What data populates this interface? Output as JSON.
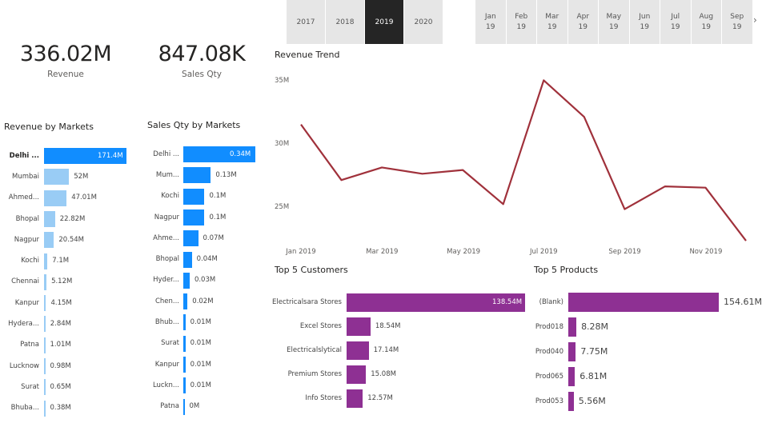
{
  "year_slicer": {
    "options": [
      "2017",
      "2018",
      "2019",
      "2020"
    ],
    "selected": "2019"
  },
  "month_slicer": {
    "options": [
      "Jan\n19",
      "Feb\n19",
      "Mar\n19",
      "Apr\n19",
      "May\n19",
      "Jun\n19",
      "Jul\n19",
      "Aug\n19",
      "Sep\n19"
    ]
  },
  "cards": {
    "revenue": {
      "value": "336.02M",
      "label": "Revenue"
    },
    "sales_qty": {
      "value": "847.08K",
      "label": "Sales Qty"
    }
  },
  "revenue_by_markets": {
    "title": "Revenue by Markets",
    "color": "#99ccf5",
    "highlight_color": "#118dff",
    "items": [
      {
        "cat": "Delhi ...",
        "value": 171.4,
        "label": "171.4M"
      },
      {
        "cat": "Mumbai",
        "value": 52,
        "label": "52M"
      },
      {
        "cat": "Ahmed...",
        "value": 47.01,
        "label": "47.01M"
      },
      {
        "cat": "Bhopal",
        "value": 22.82,
        "label": "22.82M"
      },
      {
        "cat": "Nagpur",
        "value": 20.54,
        "label": "20.54M"
      },
      {
        "cat": "Kochi",
        "value": 7.1,
        "label": "7.1M"
      },
      {
        "cat": "Chennai",
        "value": 5.12,
        "label": "5.12M"
      },
      {
        "cat": "Kanpur",
        "value": 4.15,
        "label": "4.15M"
      },
      {
        "cat": "Hydera...",
        "value": 2.84,
        "label": "2.84M"
      },
      {
        "cat": "Patna",
        "value": 1.01,
        "label": "1.01M"
      },
      {
        "cat": "Lucknow",
        "value": 0.98,
        "label": "0.98M"
      },
      {
        "cat": "Surat",
        "value": 0.65,
        "label": "0.65M"
      },
      {
        "cat": "Bhuba...",
        "value": 0.38,
        "label": "0.38M"
      }
    ]
  },
  "sales_qty_by_markets": {
    "title": "Sales Qty by Markets",
    "color": "#118dff",
    "items": [
      {
        "cat": "Delhi ...",
        "value": 0.34,
        "label": "0.34M"
      },
      {
        "cat": "Mum...",
        "value": 0.13,
        "label": "0.13M"
      },
      {
        "cat": "Kochi",
        "value": 0.1,
        "label": "0.1M"
      },
      {
        "cat": "Nagpur",
        "value": 0.1,
        "label": "0.1M"
      },
      {
        "cat": "Ahme...",
        "value": 0.07,
        "label": "0.07M"
      },
      {
        "cat": "Bhopal",
        "value": 0.04,
        "label": "0.04M"
      },
      {
        "cat": "Hyder...",
        "value": 0.03,
        "label": "0.03M"
      },
      {
        "cat": "Chen...",
        "value": 0.02,
        "label": "0.02M"
      },
      {
        "cat": "Bhub...",
        "value": 0.01,
        "label": "0.01M"
      },
      {
        "cat": "Surat",
        "value": 0.01,
        "label": "0.01M"
      },
      {
        "cat": "Kanpur",
        "value": 0.01,
        "label": "0.01M"
      },
      {
        "cat": "Luckn...",
        "value": 0.01,
        "label": "0.01M"
      },
      {
        "cat": "Patna",
        "value": 0,
        "label": "0M"
      }
    ]
  },
  "revenue_trend": {
    "title": "Revenue Trend",
    "color": "#a0313b",
    "y_ticks": [
      "35M",
      "30M",
      "25M"
    ],
    "x_ticks": [
      "Jan 2019",
      "Mar 2019",
      "May 2019",
      "Jul 2019",
      "Sep 2019",
      "Nov 2019"
    ]
  },
  "top5_customers": {
    "title": "Top 5 Customers",
    "color": "#8e3093",
    "items": [
      {
        "cat": "Electricalsara Stores",
        "value": 138.54,
        "label": "138.54M"
      },
      {
        "cat": "Excel Stores",
        "value": 18.54,
        "label": "18.54M"
      },
      {
        "cat": "Electricalslytical",
        "value": 17.14,
        "label": "17.14M"
      },
      {
        "cat": "Premium Stores",
        "value": 15.08,
        "label": "15.08M"
      },
      {
        "cat": "Info Stores",
        "value": 12.57,
        "label": "12.57M"
      }
    ]
  },
  "top5_products": {
    "title": "Top 5 Products",
    "color": "#8e3093",
    "items": [
      {
        "cat": "(Blank)",
        "value": 154.61,
        "label": "154.61M"
      },
      {
        "cat": "Prod018",
        "value": 8.28,
        "label": "8.28M"
      },
      {
        "cat": "Prod040",
        "value": 7.75,
        "label": "7.75M"
      },
      {
        "cat": "Prod065",
        "value": 6.81,
        "label": "6.81M"
      },
      {
        "cat": "Prod053",
        "value": 5.56,
        "label": "5.56M"
      }
    ]
  },
  "chart_data": [
    {
      "type": "line",
      "title": "Revenue Trend",
      "x": [
        "Jan 2019",
        "Feb 2019",
        "Mar 2019",
        "Apr 2019",
        "May 2019",
        "Jun 2019",
        "Jul 2019",
        "Aug 2019",
        "Sep 2019",
        "Oct 2019",
        "Nov 2019",
        "Dec 2019"
      ],
      "values": [
        31.6,
        27.2,
        28.2,
        27.7,
        28.0,
        25.3,
        35.1,
        32.2,
        24.9,
        26.7,
        26.6,
        22.4
      ],
      "ylim": [
        22,
        36
      ],
      "ylabel": "",
      "xlabel": "",
      "unit": "M"
    },
    {
      "type": "bar",
      "title": "Revenue by Markets",
      "categories": [
        "Delhi ...",
        "Mumbai",
        "Ahmed...",
        "Bhopal",
        "Nagpur",
        "Kochi",
        "Chennai",
        "Kanpur",
        "Hydera...",
        "Patna",
        "Lucknow",
        "Surat",
        "Bhuba..."
      ],
      "values": [
        171.4,
        52,
        47.01,
        22.82,
        20.54,
        7.1,
        5.12,
        4.15,
        2.84,
        1.01,
        0.98,
        0.65,
        0.38
      ]
    },
    {
      "type": "bar",
      "title": "Sales Qty by Markets",
      "categories": [
        "Delhi ...",
        "Mum...",
        "Kochi",
        "Nagpur",
        "Ahme...",
        "Bhopal",
        "Hyder...",
        "Chen...",
        "Bhub...",
        "Surat",
        "Kanpur",
        "Luckn...",
        "Patna"
      ],
      "values": [
        0.34,
        0.13,
        0.1,
        0.1,
        0.07,
        0.04,
        0.03,
        0.02,
        0.01,
        0.01,
        0.01,
        0.01,
        0
      ]
    },
    {
      "type": "bar",
      "title": "Top 5 Customers",
      "categories": [
        "Electricalsara Stores",
        "Excel Stores",
        "Electricalslytical",
        "Premium Stores",
        "Info Stores"
      ],
      "values": [
        138.54,
        18.54,
        17.14,
        15.08,
        12.57
      ]
    },
    {
      "type": "bar",
      "title": "Top 5 Products",
      "categories": [
        "(Blank)",
        "Prod018",
        "Prod040",
        "Prod065",
        "Prod053"
      ],
      "values": [
        154.61,
        8.28,
        7.75,
        6.81,
        5.56
      ]
    }
  ]
}
